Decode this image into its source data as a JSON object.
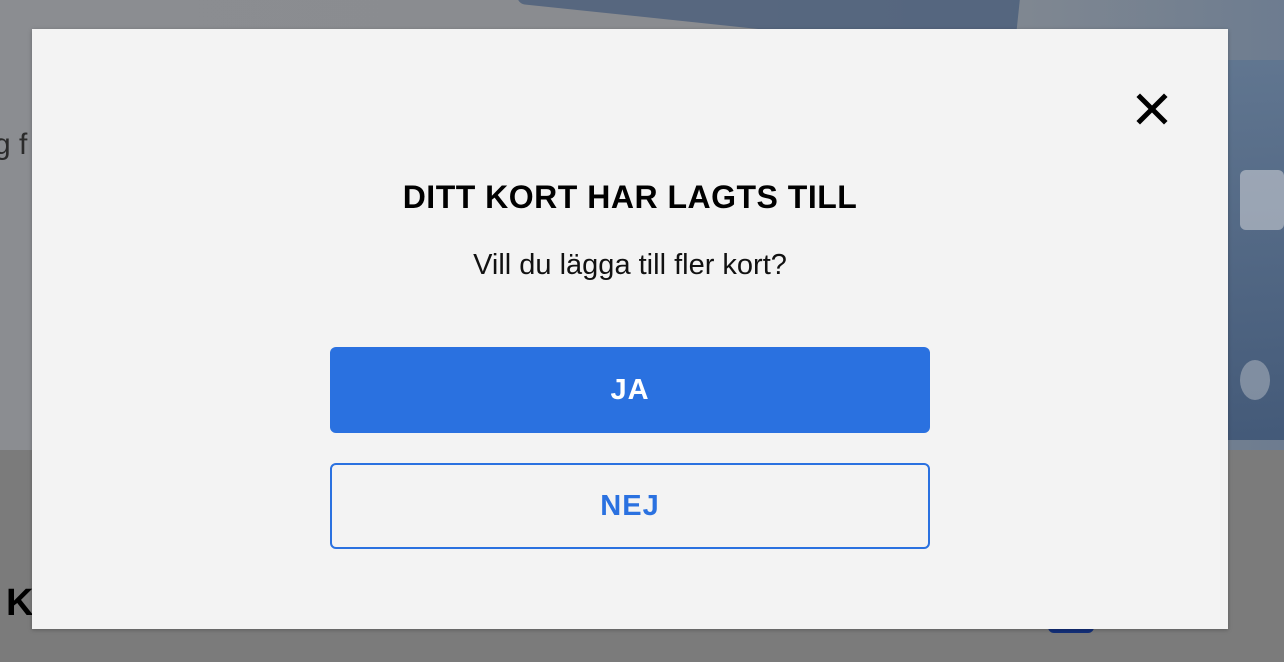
{
  "background": {
    "text_fragment": "g f",
    "heading_fragment": "Ko"
  },
  "modal": {
    "title": "DITT KORT HAR LAGTS TILL",
    "subtitle": "Vill du lägga till fler kort?",
    "yes_label": "JA",
    "no_label": "NEJ",
    "close_icon": "close-icon"
  },
  "colors": {
    "accent": "#2a71e0",
    "modal_bg": "#f3f3f3",
    "overlay": "#7a7a7a"
  }
}
